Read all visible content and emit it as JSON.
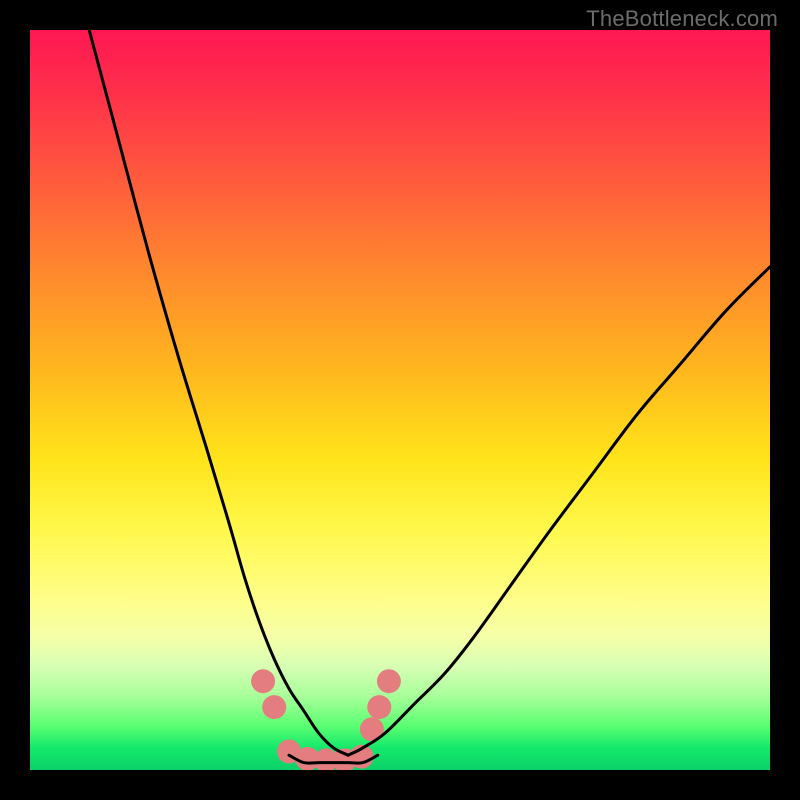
{
  "watermark": "TheBottleneck.com",
  "chart_data": {
    "type": "line",
    "title": "",
    "xlabel": "",
    "ylabel": "",
    "xlim": [
      0,
      100
    ],
    "ylim": [
      0,
      100
    ],
    "grid": false,
    "legend": null,
    "series": [
      {
        "name": "left-curve",
        "x": [
          8,
          12,
          16,
          20,
          24,
          27,
          29,
          31,
          33,
          35,
          37,
          39,
          41,
          43
        ],
        "y": [
          100,
          85,
          70,
          56,
          43,
          33,
          26,
          20,
          15,
          11,
          8,
          5,
          3,
          2
        ]
      },
      {
        "name": "right-curve",
        "x": [
          43,
          45,
          48,
          52,
          56,
          60,
          65,
          70,
          76,
          82,
          88,
          94,
          100
        ],
        "y": [
          2,
          3,
          5,
          9,
          13,
          18,
          25,
          32,
          40,
          48,
          55,
          62,
          68
        ]
      },
      {
        "name": "floor",
        "x": [
          35,
          37,
          39,
          41,
          43,
          45,
          47
        ],
        "y": [
          2,
          1,
          1,
          1,
          1,
          1,
          2
        ]
      }
    ],
    "markers": {
      "name": "highlight-dots",
      "color": "#e37d80",
      "radius_px": 12,
      "points": [
        {
          "x": 31.5,
          "y": 12
        },
        {
          "x": 33.0,
          "y": 8.5
        },
        {
          "x": 35.0,
          "y": 2.5
        },
        {
          "x": 37.5,
          "y": 1.5
        },
        {
          "x": 40.0,
          "y": 1.3
        },
        {
          "x": 42.5,
          "y": 1.3
        },
        {
          "x": 44.8,
          "y": 1.8
        },
        {
          "x": 46.2,
          "y": 5.5
        },
        {
          "x": 47.2,
          "y": 8.5
        },
        {
          "x": 48.5,
          "y": 12
        }
      ]
    },
    "gradient_stops": [
      {
        "pos": 0.0,
        "color": "#ff1752"
      },
      {
        "pos": 0.08,
        "color": "#ff2e4b"
      },
      {
        "pos": 0.2,
        "color": "#ff5a3d"
      },
      {
        "pos": 0.34,
        "color": "#ff8d2c"
      },
      {
        "pos": 0.46,
        "color": "#ffb71e"
      },
      {
        "pos": 0.58,
        "color": "#ffe41a"
      },
      {
        "pos": 0.68,
        "color": "#fff94e"
      },
      {
        "pos": 0.76,
        "color": "#fffd83"
      },
      {
        "pos": 0.82,
        "color": "#f5ffa8"
      },
      {
        "pos": 0.86,
        "color": "#d7ffb3"
      },
      {
        "pos": 0.9,
        "color": "#a8ff9a"
      },
      {
        "pos": 0.94,
        "color": "#5cff72"
      },
      {
        "pos": 0.97,
        "color": "#14e96b"
      },
      {
        "pos": 1.0,
        "color": "#0bd168"
      }
    ]
  }
}
